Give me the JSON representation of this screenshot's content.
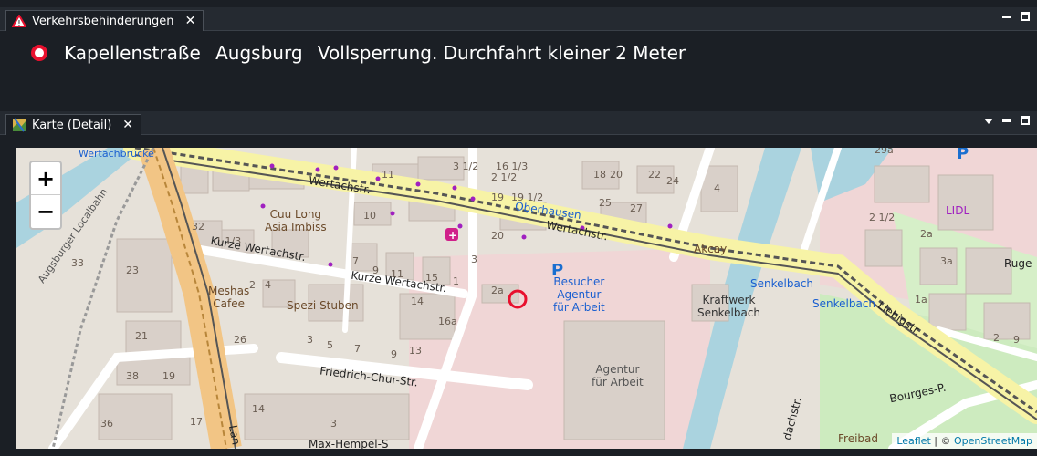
{
  "panel_top": {
    "tab_title": "Verkehrsbehinderungen",
    "tab_close": "✕",
    "message": {
      "street": "Kapellenstraße",
      "city": "Augsburg",
      "text": "Vollsperrung. Durchfahrt kleiner 2 Meter"
    }
  },
  "panel_map": {
    "tab_title": "Karte (Detail)",
    "tab_close": "✕",
    "zoom_in": "+",
    "zoom_out": "−",
    "attribution": {
      "leaflet": "Leaflet",
      "sep": " | © ",
      "osm": "OpenStreetMap"
    },
    "labels": {
      "wertachbruecke": "Wertachbrücke",
      "wertachstr_1": "Wertachstr.",
      "wertachstr_2": "Wertachstr.",
      "oberhausen": "Oberhausen",
      "kurze_wertachstr_1": "Kurze Wertachstr.",
      "kurze_wertachstr_2": "Kurze Wertachstr.",
      "cuu_long": "Cuu Long\nAsia Imbiss",
      "meshas": "Meshas\nCafee",
      "spezi": "Spezi Stuben",
      "friedrich": "Friedrich-Chur-Str.",
      "besucher": "Besucher\nAgentur\nfür Arbeit",
      "agentur": "Agentur\nfür Arbeit",
      "kraftwerk": "Kraftwerk\nSenkelbach",
      "senkelbach_1": "Senkelbach",
      "senkelbach_2": "Senkelbach",
      "akcay": "Akcay",
      "lidl": "LIDL",
      "liebigstr": "Liebigstr.",
      "bourges": "Bourges-P.",
      "freibad": "Freibad",
      "augsburger_localbahn": "Augsburger Localbahn",
      "max_hempel": "Max-Hempel-S",
      "ruge": "Ruge",
      "dachstr": "dachstr.",
      "lang": "Lan",
      "house_numbers": [
        "3 1/2",
        "16 1/3",
        "2 1/2",
        "18",
        "20",
        "22",
        "24",
        "11",
        "19",
        "19 1/2",
        "25",
        "27",
        "10",
        "20",
        "3",
        "1 1/3",
        "32",
        "7",
        "9",
        "11",
        "15",
        "1",
        "2",
        "4",
        "14",
        "16a",
        "2a",
        "21",
        "26",
        "3",
        "5",
        "7",
        "9",
        "13",
        "38",
        "19",
        "36",
        "17",
        "14",
        "3",
        "33",
        "23",
        "4",
        "2 1/2",
        "2a",
        "3a",
        "1a",
        "2",
        "9",
        "29a"
      ]
    }
  }
}
